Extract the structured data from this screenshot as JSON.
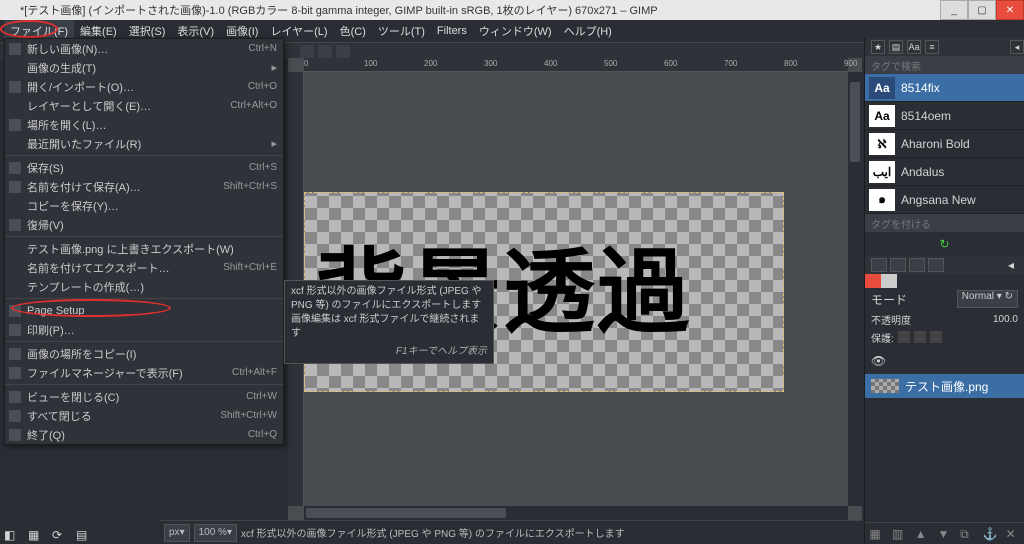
{
  "window": {
    "title": "*[テスト画像] (インポートされた画像)-1.0 (RGBカラー 8-bit gamma integer, GIMP built-in sRGB, 1枚のレイヤー) 670x271 – GIMP"
  },
  "menubar": {
    "items": [
      "ファイル(F)",
      "編集(E)",
      "選択(S)",
      "表示(V)",
      "画像(I)",
      "レイヤー(L)",
      "色(C)",
      "ツール(T)",
      "Filters",
      "ウィンドウ(W)",
      "ヘルプ(H)"
    ]
  },
  "file_menu": [
    {
      "label": "新しい画像(N)…",
      "shortcut": "Ctrl+N",
      "icon": true
    },
    {
      "label": "画像の生成(T)",
      "arrow": true
    },
    {
      "label": "開く/インポート(O)…",
      "shortcut": "Ctrl+O",
      "icon": true
    },
    {
      "label": "レイヤーとして開く(E)…",
      "shortcut": "Ctrl+Alt+O"
    },
    {
      "label": "場所を開く(L)…",
      "icon": true
    },
    {
      "label": "最近開いたファイル(R)",
      "arrow": true
    },
    {
      "sep": true
    },
    {
      "label": "保存(S)",
      "shortcut": "Ctrl+S",
      "icon": true
    },
    {
      "label": "名前を付けて保存(A)…",
      "shortcut": "Shift+Ctrl+S",
      "icon": true
    },
    {
      "label": "コピーを保存(Y)…"
    },
    {
      "label": "復帰(V)",
      "icon": true
    },
    {
      "sep": true
    },
    {
      "label": "テスト画像.png に上書きエクスポート(W)"
    },
    {
      "label": "名前を付けてエクスポート…",
      "shortcut": "Shift+Ctrl+E",
      "highlight": true
    },
    {
      "label": "テンプレートの作成(…)"
    },
    {
      "sep": true
    },
    {
      "label": "Page Setup",
      "icon": true
    },
    {
      "label": "印刷(P)…",
      "icon": true
    },
    {
      "sep": true
    },
    {
      "label": "画像の場所をコピー(I)",
      "icon": true
    },
    {
      "label": "ファイルマネージャーで表示(F)",
      "shortcut": "Ctrl+Alt+F",
      "icon": true
    },
    {
      "sep": true
    },
    {
      "label": "ビューを閉じる(C)",
      "shortcut": "Ctrl+W",
      "icon": true
    },
    {
      "label": "すべて閉じる",
      "shortcut": "Shift+Ctrl+W",
      "icon": true
    },
    {
      "label": "終了(Q)",
      "shortcut": "Ctrl+Q",
      "icon": true
    }
  ],
  "tooltip": {
    "line1": "xcf 形式以外の画像ファイル形式 (JPEG や PNG 等) のファイルにエクスポートします 画像編集は xcf 形式ファイルで継続されます",
    "f1": "F1キーでヘルプ表示"
  },
  "canvas": {
    "ruler_marks": [
      "0",
      "100",
      "200",
      "300",
      "400",
      "500",
      "600",
      "700",
      "800",
      "900"
    ],
    "text": "背景透過"
  },
  "statusbar": {
    "unit": "px",
    "zoom": "100 %",
    "msg": "xcf 形式以外の画像ファイル形式 (JPEG や PNG 等) のファイルにエクスポートします"
  },
  "right": {
    "tag_search": "タグで検索",
    "tag_add": "タグを付ける",
    "fonts": [
      {
        "preview": "Aa",
        "name": "8514fix",
        "sel": true
      },
      {
        "preview": "Aa",
        "name": "8514oem"
      },
      {
        "preview": "ℵ",
        "name": "Aharoni Bold"
      },
      {
        "preview": "ايب",
        "name": "Andalus"
      },
      {
        "preview": "๑",
        "name": "Angsana New"
      }
    ],
    "refresh": "↻",
    "mode_label": "モード",
    "mode_value": "Normal",
    "opacity_label": "不透明度",
    "opacity_value": "100.0",
    "protect_label": "保護:",
    "layer_name": "テスト画像.png"
  }
}
